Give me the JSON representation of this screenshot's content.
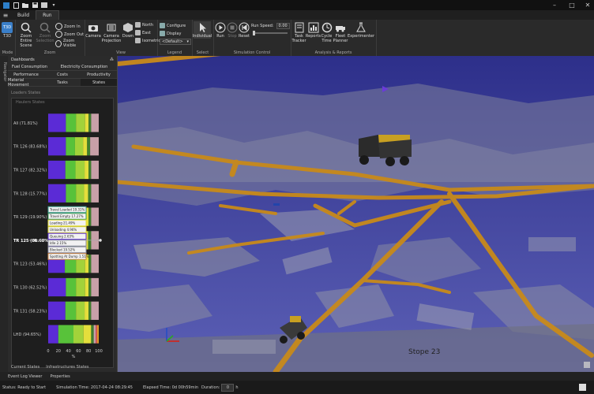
{
  "menu": {
    "tabs": [
      "Build",
      "Run"
    ],
    "active": "Run"
  },
  "ribbon": {
    "groups": {
      "mode": {
        "label": "Mode",
        "t3d": "T3D"
      },
      "zoom": {
        "label": "Zoom",
        "zoom_entire": "Zoom Entire Scene",
        "zoom_selection": "Zoom Selection",
        "zoom_in": "Zoom In",
        "zoom_out": "Zoom Out",
        "zoom_visible": "Zoom Visible"
      },
      "view": {
        "label": "View",
        "camera": "Camera",
        "camera_projection": "Camera Projection",
        "down": "Down",
        "north": "North",
        "east": "East",
        "isometric": "Isometric"
      },
      "legend": {
        "label": "Legend",
        "configure": "Configure",
        "display": "Display",
        "default": "<Default>"
      },
      "select": {
        "label": "Select",
        "individual": "Individual"
      },
      "simulation": {
        "label": "Simulation Control",
        "run": "Run",
        "stop": "Stop",
        "reset": "Reset",
        "run_speed_label": "Run Speed:",
        "run_speed_value": "0.00"
      },
      "analysis": {
        "label": "Analysis & Reports",
        "task_tracker": "Task Tracker",
        "reports": "Reports",
        "cycle_time": "Cycle Time",
        "fleet_planner": "Fleet Planner",
        "experimenter": "Experimenter"
      }
    }
  },
  "navigator_label": "Navigator",
  "dashboards": {
    "title": "Dashboards",
    "tabs": [
      "Fuel Consumption",
      "Electricity Consumption",
      "Performance",
      "Costs",
      "Productivity",
      "Material Movement",
      "Tasks",
      "States"
    ],
    "active_tab": "States",
    "loaders_label": "Loaders States",
    "haulers_label": "Haulers States",
    "bottom_tabs": [
      "Current States",
      "Infrastructures States"
    ]
  },
  "chart_data": {
    "type": "bar",
    "orientation": "horizontal-stacked",
    "categories": [
      "All (71.81%)",
      "TR 126 (83.68%)",
      "TR 127 (82.32%)",
      "TR 128 (15.77%)",
      "TR 129 (19.90%)",
      "TR 125 (81.68%)",
      "TR 123 (53.46%)",
      "TR 130 (62.52%)",
      "TR 131 (58.23%)",
      "LHD (94.65%)"
    ],
    "xlabel": "%",
    "xlim": [
      0,
      100
    ],
    "xticks": [
      0,
      20,
      40,
      60,
      80,
      100
    ],
    "selected_category": "TR 125 (81.68%)",
    "series_colors": [
      "#5b2bd6",
      "#58c23a",
      "#a2d23a",
      "#e4de3c",
      "#3e7f2e",
      "#c8a0a8",
      "#d65a5a",
      "#e89c2b"
    ],
    "rows": [
      [
        35,
        20,
        18,
        7,
        5,
        15,
        0,
        0
      ],
      [
        35,
        18,
        16,
        8,
        6,
        17,
        0,
        0
      ],
      [
        34,
        20,
        18,
        8,
        5,
        15,
        0,
        0
      ],
      [
        35,
        20,
        16,
        8,
        6,
        15,
        0,
        0
      ],
      [
        35,
        20,
        17,
        8,
        5,
        15,
        0,
        0
      ],
      [
        35,
        20,
        18,
        6,
        6,
        15,
        0,
        0
      ],
      [
        33,
        22,
        18,
        7,
        5,
        15,
        0,
        0
      ],
      [
        35,
        20,
        18,
        7,
        5,
        15,
        0,
        0
      ],
      [
        34,
        21,
        17,
        8,
        5,
        15,
        0,
        0
      ],
      [
        20,
        30,
        20,
        15,
        5,
        4,
        3,
        3
      ]
    ],
    "tooltip_lines": [
      "Travel Loaded 19.31%",
      "Travel Empty 17.27%",
      "Loading 21.49%",
      "Unloading 4.96%",
      "Queuing 2.63%",
      "Idle 2.15%",
      "Blocked 19.52%",
      "Spotting At Dump 1.51%"
    ]
  },
  "viewport": {
    "label": "Stope 23"
  },
  "log_tabs": [
    "Event Log Viewer",
    "Properties"
  ],
  "status": {
    "status_text": "Status: Ready to Start",
    "sim_time": "Simulation Time: 2017-04-24 08:29:45",
    "elapsed": "Elapsed Time: 0d 00h59min",
    "duration_label": "Duration:",
    "duration_value": "0",
    "duration_unit": "h"
  },
  "colors": {
    "accent": "#c88a1a",
    "ribbon_bg": "#2a2a2a",
    "sky": "#3b3f8a"
  }
}
